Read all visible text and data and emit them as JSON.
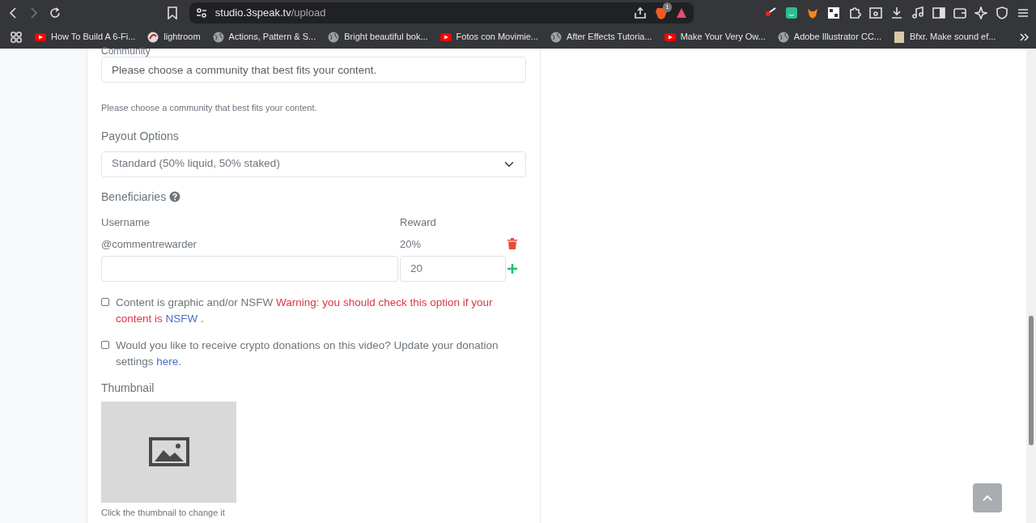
{
  "browser": {
    "url_host": "studio.3speak.tv",
    "url_path": "/upload",
    "shield_badge": "1",
    "bookmarks": [
      {
        "kind": "youtube",
        "label": "How To Build A 6-Fi..."
      },
      {
        "kind": "lightroom",
        "label": "lightroom"
      },
      {
        "kind": "globe",
        "label": "Actions, Pattern & S..."
      },
      {
        "kind": "globe",
        "label": "Bright beautiful bok..."
      },
      {
        "kind": "youtube",
        "label": "Fotos con Movimie..."
      },
      {
        "kind": "globe",
        "label": "After Effects Tutoria..."
      },
      {
        "kind": "youtube",
        "label": "Make Your Very Ow..."
      },
      {
        "kind": "globe",
        "label": "Adobe Illustrator CC..."
      },
      {
        "kind": "image",
        "label": "Bfxr. Make sound ef..."
      }
    ]
  },
  "form": {
    "community": {
      "label": "Community",
      "placeholder": "Please choose a community that best fits your content.",
      "help": "Please choose a community that best fits your content."
    },
    "payout": {
      "label": "Payout Options",
      "value": "Standard (50% liquid, 50% staked)"
    },
    "beneficiaries": {
      "label": "Beneficiaries",
      "columns": [
        "Username",
        "Reward"
      ],
      "rows": [
        {
          "username": "@commentrewarder",
          "reward": "20%"
        }
      ],
      "new_entry": {
        "reward": "20"
      }
    },
    "checkboxes": [
      {
        "checked": false,
        "parts": [
          {
            "kind": "plain",
            "text": "Content is graphic and/or NSFW "
          },
          {
            "kind": "warning",
            "text": "Warning: you should check this option if your content is "
          },
          {
            "kind": "link",
            "text": "NSFW"
          },
          {
            "kind": "warning",
            "text": " ."
          }
        ]
      },
      {
        "checked": false,
        "parts": [
          {
            "kind": "plain",
            "text": "Would you like to receive crypto donations on this video? Update your donation settings "
          },
          {
            "kind": "link",
            "text": "here."
          }
        ]
      }
    ],
    "thumbnail": {
      "label": "Thumbnail",
      "caption": "Click the thumbnail to change it"
    }
  }
}
